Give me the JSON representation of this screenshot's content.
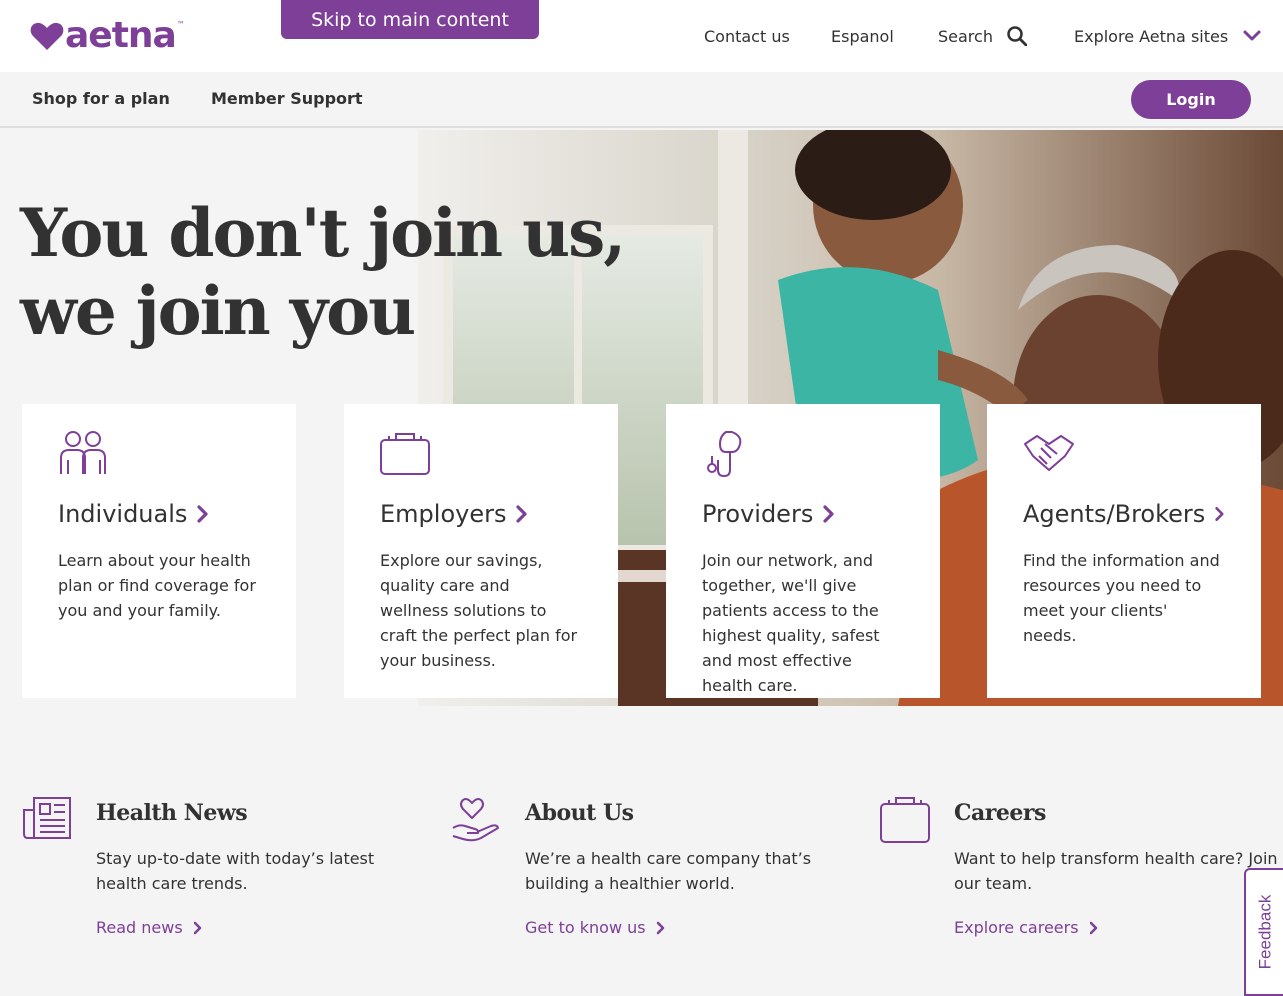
{
  "header": {
    "logo_text": "aetna",
    "logo_tm": "™",
    "skip_link": "Skip to main content",
    "contact": "Contact us",
    "espanol": "Espanol",
    "search": "Search",
    "explore": "Explore Aetna sites",
    "search_icon": "search-icon",
    "explore_icon": "chevron-down-icon"
  },
  "subnav": {
    "shop": "Shop for a plan",
    "member": "Member Support",
    "login": "Login"
  },
  "hero": {
    "title": "You don't join us, we join you"
  },
  "cards": [
    {
      "title": "Individuals",
      "icon": "people-icon",
      "desc": "Learn about your health plan or find coverage for you and your family."
    },
    {
      "title": "Employers",
      "icon": "briefcase-icon",
      "desc": "Explore our savings, quality care and wellness solutions to craft the perfect plan for your business."
    },
    {
      "title": "Providers",
      "icon": "stethoscope-icon",
      "desc": "Join our network, and together, we'll give patients access to the highest quality, safest and most effective health care."
    },
    {
      "title": "Agents/Brokers",
      "icon": "handshake-icon",
      "desc": "Find the information and resources you need to meet your clients' needs."
    }
  ],
  "info": [
    {
      "title": "Health News",
      "icon": "newspaper-icon",
      "desc": "Stay up-to-date with today’s latest health care trends.",
      "link": "Read news"
    },
    {
      "title": "About Us",
      "icon": "heart-hand-icon",
      "desc": "We’re a health care company that’s building a healthier world.",
      "link": "Get to know us"
    },
    {
      "title": "Careers",
      "icon": "briefcase-icon",
      "desc": "Want to help transform health care? Join our team.",
      "link": "Explore careers"
    }
  ],
  "feedback": "Feedback",
  "colors": {
    "brand": "#7d3f98",
    "text": "#323232",
    "background": "#f4f4f4"
  }
}
